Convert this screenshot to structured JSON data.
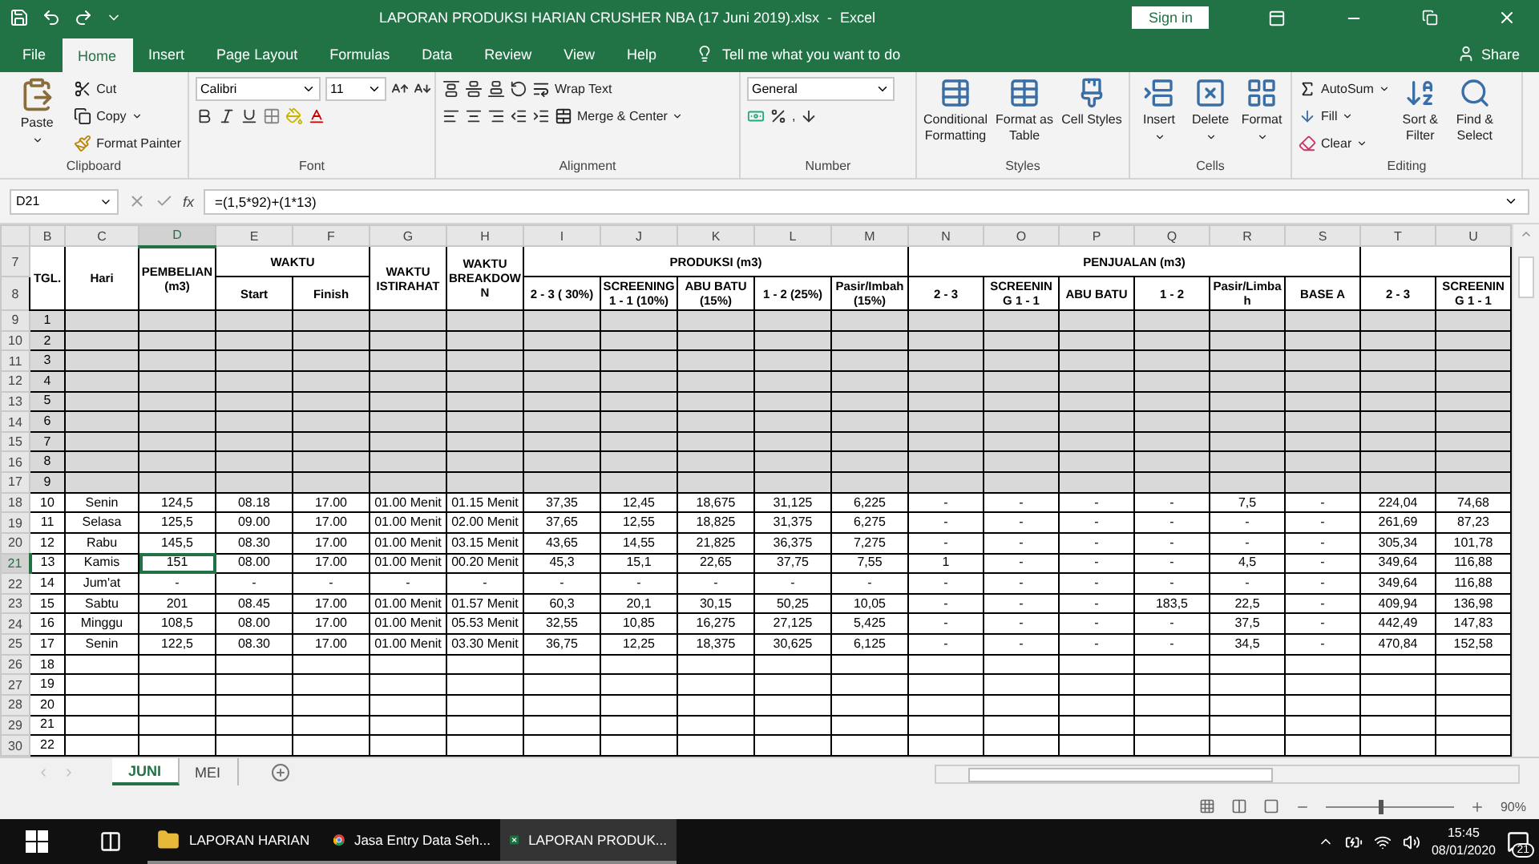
{
  "title_bar": {
    "title": "LAPORAN PRODUKSI HARIAN CRUSHER NBA (17 Juni 2019).xlsx  -  Excel",
    "sign_in": "Sign in"
  },
  "menu_tabs": [
    {
      "label": "File",
      "selected": false
    },
    {
      "label": "Home",
      "selected": true
    },
    {
      "label": "Insert",
      "selected": false
    },
    {
      "label": "Page Layout",
      "selected": false
    },
    {
      "label": "Formulas",
      "selected": false
    },
    {
      "label": "Data",
      "selected": false
    },
    {
      "label": "Review",
      "selected": false
    },
    {
      "label": "View",
      "selected": false
    },
    {
      "label": "Help",
      "selected": false
    }
  ],
  "tell_me": "Tell me what you want to do",
  "share": "Share",
  "ribbon": [
    {
      "kind": "clipboard",
      "label": "Clipboard",
      "paste": "Paste",
      "cut": "Cut",
      "copy": "Copy",
      "format_painter": "Format Painter"
    },
    {
      "kind": "font",
      "label": "Font",
      "font_name": "Calibri",
      "font_size": "11"
    },
    {
      "kind": "alignment",
      "label": "Alignment",
      "wrap_text": "Wrap Text",
      "merge_center": "Merge & Center"
    },
    {
      "kind": "number",
      "label": "Number",
      "format": "General",
      "comma": ","
    },
    {
      "kind": "styles",
      "label": "Styles",
      "buttons": [
        "Conditional Formatting",
        "Format as Table",
        "Cell Styles"
      ]
    },
    {
      "kind": "cells",
      "label": "Cells",
      "buttons": [
        "Insert",
        "Delete",
        "Format"
      ]
    },
    {
      "kind": "editing",
      "label": "Editing",
      "autosum": "AutoSum",
      "fill": "Fill",
      "clear": "Clear",
      "buttons": [
        "Sort & Filter",
        "Find & Select"
      ]
    }
  ],
  "formula_bar": {
    "name_box": "D21",
    "fx": "fx",
    "formula": "=(1,5*92)+(1*13)"
  },
  "sheet": {
    "columns": [
      {
        "letter": "B",
        "selected": false
      },
      {
        "letter": "C",
        "selected": false
      },
      {
        "letter": "D",
        "selected": true
      },
      {
        "letter": "E",
        "selected": false
      },
      {
        "letter": "F",
        "selected": false
      },
      {
        "letter": "G",
        "selected": false
      },
      {
        "letter": "H",
        "selected": false
      },
      {
        "letter": "I",
        "selected": false
      },
      {
        "letter": "J",
        "selected": false
      },
      {
        "letter": "K",
        "selected": false
      },
      {
        "letter": "L",
        "selected": false
      },
      {
        "letter": "M",
        "selected": false
      },
      {
        "letter": "N",
        "selected": false
      },
      {
        "letter": "O",
        "selected": false
      },
      {
        "letter": "P",
        "selected": false
      },
      {
        "letter": "Q",
        "selected": false
      },
      {
        "letter": "R",
        "selected": false
      },
      {
        "letter": "S",
        "selected": false
      },
      {
        "letter": "T",
        "selected": false
      },
      {
        "letter": "U",
        "selected": false
      }
    ],
    "header": {
      "row_numbers": [
        "7",
        "8"
      ],
      "tgl": "TGL.",
      "hari": "Hari",
      "pembelian": "PEMBELIAN (m3)",
      "waktu": "WAKTU",
      "start": "Start",
      "finish": "Finish",
      "istirahat": "WAKTU ISTIRAHAT",
      "breakdown": "WAKTU BREAKDOWN",
      "produksi": "PRODUKSI (m3)",
      "produksi_cols": [
        "2 - 3 ( 30%)",
        "SCREENING 1 - 1 (10%)",
        "ABU BATU (15%)",
        "1 - 2 (25%)",
        "Pasir/Imbah (15%)"
      ],
      "penjualan": "PENJUALAN (m3)",
      "penjualan_cols": [
        "2 - 3",
        "SCREENING 1 - 1",
        "ABU BATU",
        "1 - 2",
        "Pasir/Limbah",
        "BASE A"
      ],
      "last_cols": [
        "2 - 3",
        "SCREENING 1 - 1"
      ]
    },
    "rows": [
      {
        "number": "9",
        "selected": false,
        "shaded": true,
        "cells": [
          "1"
        ]
      },
      {
        "number": "10",
        "selected": false,
        "shaded": true,
        "cells": [
          "2"
        ]
      },
      {
        "number": "11",
        "selected": false,
        "shaded": true,
        "cells": [
          "3"
        ]
      },
      {
        "number": "12",
        "selected": false,
        "shaded": true,
        "cells": [
          "4"
        ]
      },
      {
        "number": "13",
        "selected": false,
        "shaded": true,
        "cells": [
          "5"
        ]
      },
      {
        "number": "14",
        "selected": false,
        "shaded": true,
        "cells": [
          "6"
        ]
      },
      {
        "number": "15",
        "selected": false,
        "shaded": true,
        "cells": [
          "7"
        ]
      },
      {
        "number": "16",
        "selected": false,
        "shaded": true,
        "cells": [
          "8"
        ]
      },
      {
        "number": "17",
        "selected": false,
        "shaded": true,
        "cells": [
          "9"
        ]
      },
      {
        "number": "18",
        "selected": false,
        "shaded": false,
        "cells": [
          "10",
          "Senin",
          "124,5",
          "08.18",
          "17.00",
          "01.00 Menit",
          "01.15 Menit",
          "37,35",
          "12,45",
          "18,675",
          "31,125",
          "6,225",
          "-",
          "-",
          "-",
          "-",
          "7,5",
          "-",
          "224,04",
          "74,68"
        ]
      },
      {
        "number": "19",
        "selected": false,
        "shaded": false,
        "cells": [
          "11",
          "Selasa",
          "125,5",
          "09.00",
          "17.00",
          "01.00 Menit",
          "02.00 Menit",
          "37,65",
          "12,55",
          "18,825",
          "31,375",
          "6,275",
          "-",
          "-",
          "-",
          "-",
          "-",
          "-",
          "261,69",
          "87,23"
        ]
      },
      {
        "number": "20",
        "selected": false,
        "shaded": false,
        "cells": [
          "12",
          "Rabu",
          "145,5",
          "08.30",
          "17.00",
          "01.00 Menit",
          "03.15 Menit",
          "43,65",
          "14,55",
          "21,825",
          "36,375",
          "7,275",
          "-",
          "-",
          "-",
          "-",
          "-",
          "-",
          "305,34",
          "101,78"
        ]
      },
      {
        "number": "21",
        "selected": true,
        "shaded": false,
        "cells": [
          "13",
          "Kamis",
          "151",
          "08.00",
          "17.00",
          "01.00 Menit",
          "00.20 Menit",
          "45,3",
          "15,1",
          "22,65",
          "37,75",
          "7,55",
          "1",
          "-",
          "-",
          "-",
          "4,5",
          "-",
          "349,64",
          "116,88"
        ]
      },
      {
        "number": "22",
        "selected": false,
        "shaded": false,
        "cells": [
          "14",
          "Jum'at",
          "-",
          "-",
          "-",
          "-",
          "-",
          "-",
          "-",
          "-",
          "-",
          "-",
          "-",
          "-",
          "-",
          "-",
          "-",
          "-",
          "349,64",
          "116,88"
        ]
      },
      {
        "number": "23",
        "selected": false,
        "shaded": false,
        "cells": [
          "15",
          "Sabtu",
          "201",
          "08.45",
          "17.00",
          "01.00 Menit",
          "01.57 Menit",
          "60,3",
          "20,1",
          "30,15",
          "50,25",
          "10,05",
          "-",
          "-",
          "-",
          "183,5",
          "22,5",
          "-",
          "409,94",
          "136,98"
        ]
      },
      {
        "number": "24",
        "selected": false,
        "shaded": false,
        "cells": [
          "16",
          "Minggu",
          "108,5",
          "08.00",
          "17.00",
          "01.00 Menit",
          "05.53 Menit",
          "32,55",
          "10,85",
          "16,275",
          "27,125",
          "5,425",
          "-",
          "-",
          "-",
          "-",
          "37,5",
          "-",
          "442,49",
          "147,83"
        ]
      },
      {
        "number": "25",
        "selected": false,
        "shaded": false,
        "cells": [
          "17",
          "Senin",
          "122,5",
          "08.30",
          "17.00",
          "01.00 Menit",
          "03.30 Menit",
          "36,75",
          "12,25",
          "18,375",
          "30,625",
          "6,125",
          "-",
          "-",
          "-",
          "-",
          "34,5",
          "-",
          "470,84",
          "152,58"
        ]
      },
      {
        "number": "26",
        "selected": false,
        "shaded": false,
        "cells": [
          "18"
        ]
      },
      {
        "number": "27",
        "selected": false,
        "shaded": false,
        "cells": [
          "19"
        ]
      },
      {
        "number": "28",
        "selected": false,
        "shaded": false,
        "cells": [
          "20"
        ]
      },
      {
        "number": "29",
        "selected": false,
        "shaded": false,
        "cells": [
          "21"
        ]
      },
      {
        "number": "30",
        "selected": false,
        "shaded": false,
        "cells": [
          "22"
        ]
      }
    ]
  },
  "sheet_tabs": [
    {
      "label": "JUNI",
      "selected": true
    },
    {
      "label": "MEI",
      "selected": false
    }
  ],
  "status_bar": {
    "zoom": "90%",
    "zoom_slider": {
      "level": 0.42
    }
  },
  "taskbar": {
    "apps": [
      {
        "kind": "folder",
        "label": "LAPORAN HARIAN",
        "selected": false
      },
      {
        "kind": "browser",
        "label": "Jasa Entry Data Seh...",
        "selected": false
      },
      {
        "kind": "excel",
        "label": "LAPORAN PRODUK...",
        "selected": true
      }
    ],
    "time": "15:45",
    "date": "08/01/2020",
    "notifications": "21"
  }
}
